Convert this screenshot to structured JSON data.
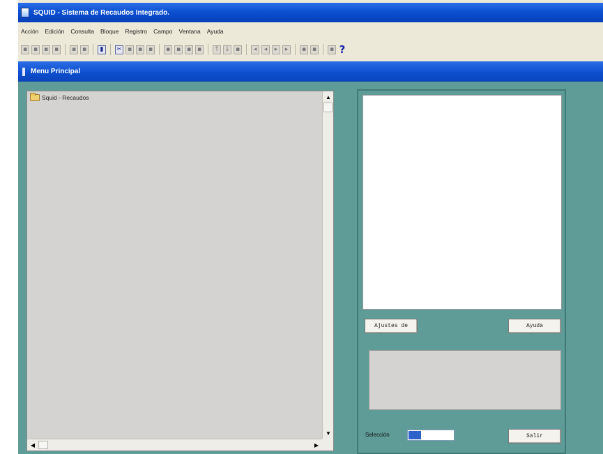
{
  "window": {
    "title": "SQUID - Sistema de Recaudos Integrado."
  },
  "menu": {
    "items": [
      "Acción",
      "Edición",
      "Consulta",
      "Bloque",
      "Registro",
      "Campo",
      "Ventana",
      "Ayuda"
    ]
  },
  "toolbar": {
    "groups": [
      [
        "save-icon",
        "print-icon",
        "edit-icon",
        "exit-icon"
      ],
      [
        "cut-icon",
        "copy-icon"
      ],
      [
        "book-icon"
      ],
      [
        "scissors-icon",
        "copy-icon",
        "paste-icon",
        "eraser-icon"
      ],
      [
        "insert-record-icon",
        "delete-record-icon",
        "duplicate-icon",
        "clear-icon"
      ],
      [
        "up-icon",
        "down-icon",
        "filter-icon"
      ],
      [
        "first-icon",
        "prev-icon",
        "next-icon",
        "last-icon"
      ],
      [
        "query-icon",
        "execute-icon"
      ],
      [
        "context-help-icon",
        "help-icon"
      ]
    ],
    "help_glyph": "?"
  },
  "child_window": {
    "title": "Menu Principal"
  },
  "tree": {
    "root_label": "Squid - Recaudos"
  },
  "buttons": {
    "ajustes": "Ajustes de",
    "ayuda": "Ayuda",
    "salir": "Salir"
  },
  "selection": {
    "label": "Selección",
    "value": "",
    "selected_color": "#2d62c8"
  },
  "colors": {
    "titlebar": "#0a4ed0",
    "workspace": "#5f9b97",
    "panel": "#d4d3d1"
  }
}
